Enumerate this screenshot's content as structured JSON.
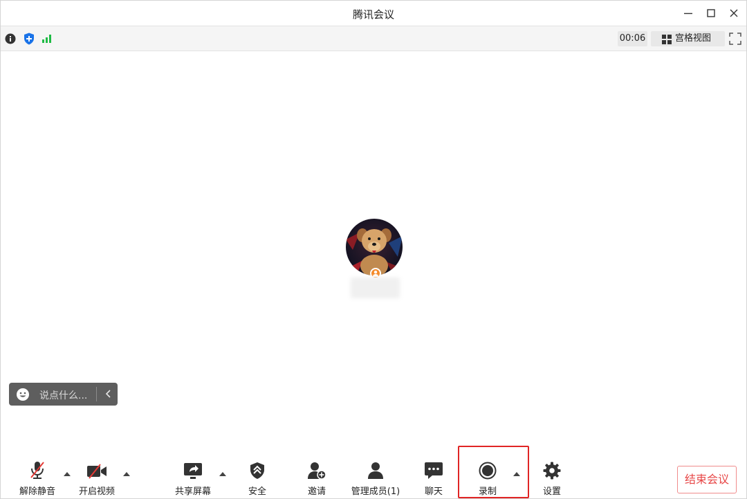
{
  "window": {
    "title": "腾讯会议"
  },
  "infobar": {
    "timer": "00:06",
    "grid_view_label": "宫格视图",
    "signal_color": "#1fbb45",
    "shield_color": "#1a73e8"
  },
  "participant": {
    "host_badge_color": "#f58a2a"
  },
  "quick_chat": {
    "placeholder": "说点什么..."
  },
  "toolbar": {
    "unmute_label": "解除静音",
    "start_video_label": "开启视频",
    "share_screen_label": "共享屏幕",
    "security_label": "安全",
    "invite_label": "邀请",
    "manage_members_label": "管理成员(1)",
    "chat_label": "聊天",
    "record_label": "录制",
    "settings_label": "设置",
    "end_meeting_label": "结束会议"
  },
  "colors": {
    "end_button": "#e74545",
    "highlight_box": "#e02424",
    "muted_slash": "#e53935"
  }
}
